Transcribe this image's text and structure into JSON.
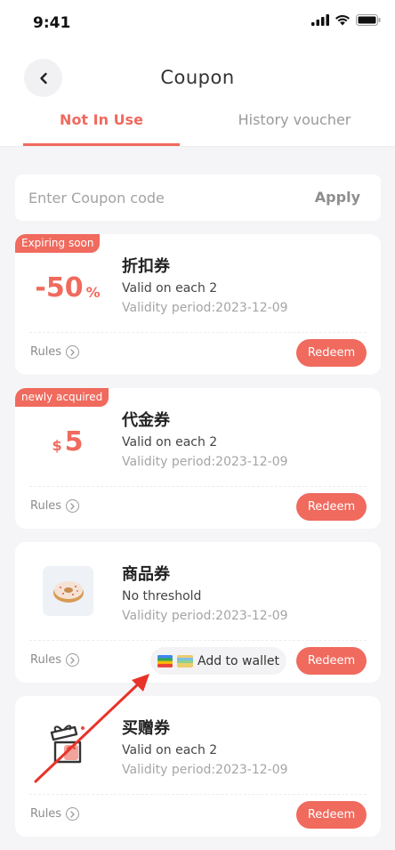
{
  "status_bar": {
    "time": "9:41"
  },
  "header": {
    "title": "Coupon"
  },
  "tabs": [
    {
      "label": "Not In Use"
    },
    {
      "label": "History voucher"
    }
  ],
  "code_entry": {
    "placeholder": "Enter Coupon code",
    "apply_label": "Apply"
  },
  "coupons": [
    {
      "badge": "Expiring soon",
      "value": "-50",
      "value_unit": "%",
      "title": "折扣券",
      "description": "Valid on each 2",
      "validity": "Validity period:2023-12-09",
      "rules_label": "Rules",
      "redeem_label": "Redeem"
    },
    {
      "badge": "newly acquired",
      "value_prefix": "$",
      "value": "5",
      "title": "代金券",
      "description": "Valid on each 2",
      "validity": "Validity period:2023-12-09",
      "rules_label": "Rules",
      "redeem_label": "Redeem"
    },
    {
      "title": "商品券",
      "description": "No threshold",
      "validity": "Validity period:2023-12-09",
      "rules_label": "Rules",
      "redeem_label": "Redeem",
      "wallet_label": "Add to wallet",
      "image_icon": "donut-icon"
    },
    {
      "title": "买赠券",
      "description": "Valid on each 2",
      "validity": "Validity period:2023-12-09",
      "rules_label": "Rules",
      "redeem_label": "Redeem",
      "image_icon": "gift-box-icon"
    }
  ],
  "colors": {
    "accent": "#f06a5e",
    "background": "#f5f5f7",
    "annotation_arrow": "#e8332a"
  }
}
